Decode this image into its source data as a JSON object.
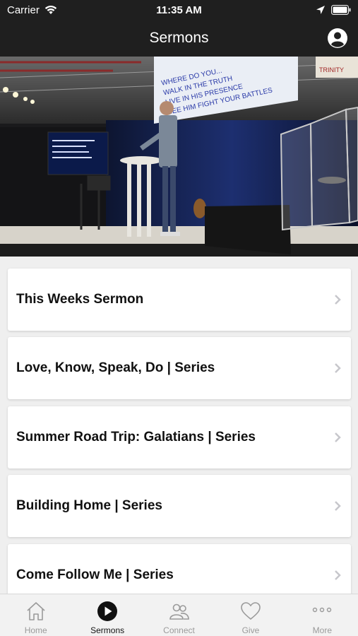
{
  "status_bar": {
    "carrier": "Carrier",
    "time": "11:35 AM"
  },
  "nav": {
    "title": "Sermons"
  },
  "hero": {
    "projector_lines": [
      "WHERE DO YOU...",
      "WALK IN THE TRUTH",
      "LIVE IN HIS PRESENCE",
      "SEE HIM FIGHT YOUR BATTLES"
    ],
    "banner": "TRINITY"
  },
  "sermons": [
    {
      "label": "This Weeks Sermon"
    },
    {
      "label": "Love, Know, Speak, Do | Series"
    },
    {
      "label": "Summer Road Trip: Galatians | Series"
    },
    {
      "label": "Building Home | Series"
    },
    {
      "label": "Come Follow Me | Series"
    }
  ],
  "tabs": [
    {
      "label": "Home",
      "icon": "home-icon"
    },
    {
      "label": "Sermons",
      "icon": "play-icon"
    },
    {
      "label": "Connect",
      "icon": "people-icon"
    },
    {
      "label": "Give",
      "icon": "heart-icon"
    },
    {
      "label": "More",
      "icon": "more-icon"
    }
  ],
  "colors": {
    "bar": "#1f1f1f",
    "accent_active": "#111111",
    "tab_inactive": "#9a9a9a"
  }
}
